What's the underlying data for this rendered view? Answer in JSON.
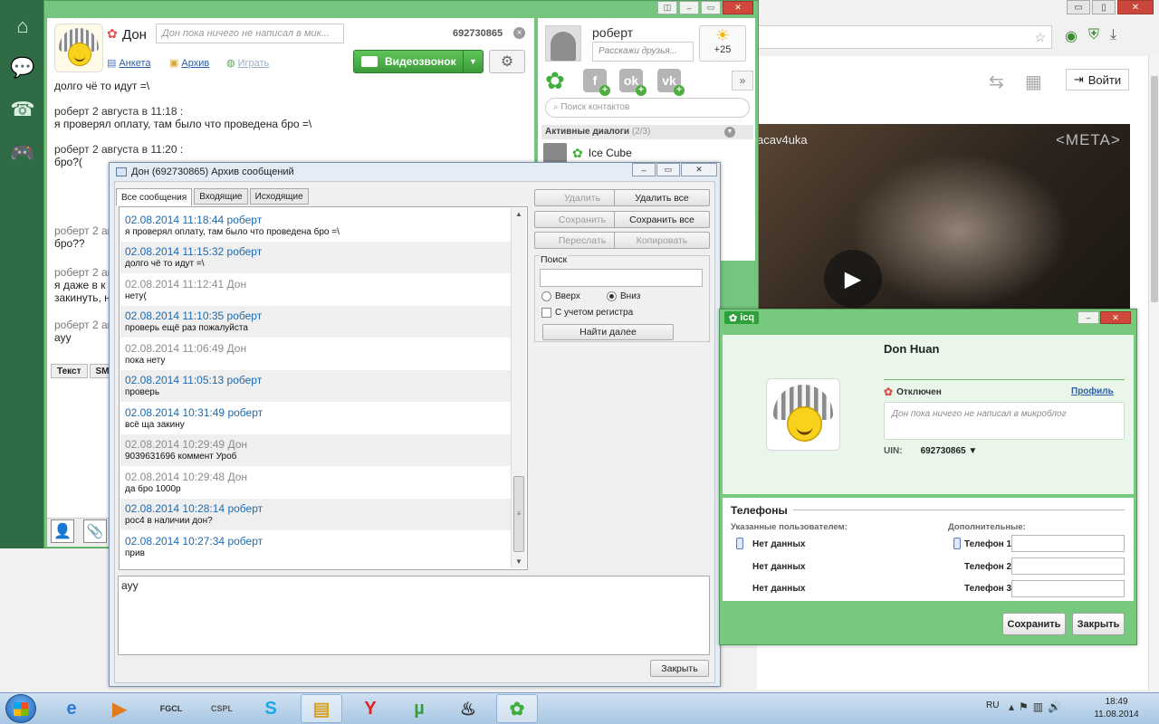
{
  "browser": {
    "login_label": "Войти",
    "video_title": "acav4uka",
    "video_brand": "<META>",
    "controls": [
      "▭",
      "▯",
      "✕"
    ]
  },
  "chat": {
    "contact_name": "Дон",
    "microblog_placeholder": "Дон пока ничего не написал в мик...",
    "uin": "692730865",
    "links": {
      "profile": "Анкета",
      "archive": "Архив",
      "play": "Играть"
    },
    "video_call": "Видеозвонок",
    "history": [
      {
        "meta": "",
        "text": "долго чё то идут =\\"
      },
      {
        "meta": "роберт 2 августа в 11:18 :",
        "text": "я проверял оплату, там было что проведена бро =\\"
      },
      {
        "meta": "роберт 2 августа в 11:20 :",
        "text": "бро?("
      },
      {
        "meta": "роберт 2 ав",
        "text": "бро??"
      },
      {
        "meta": "роберт 2 ав",
        "text": "я даже в к",
        "text2": "закинуть, н"
      },
      {
        "meta": "роберт 2 ав",
        "text": "ayy"
      }
    ],
    "input_tabs": [
      "Текст",
      "SM"
    ]
  },
  "contacts": {
    "my_name": "роберт",
    "status_placeholder": "Расскажи друзья...",
    "temperature": "+25",
    "search_placeholder": "Поиск контактов",
    "active_dialogs": "Активные диалоги",
    "active_count": "(2/3)",
    "contact": "Ice Cube",
    "more": "»"
  },
  "archive": {
    "title": "Дон (692730865) Архив сообщений",
    "tabs": [
      "Все сообщения",
      "Входящие",
      "Исходящие"
    ],
    "messages": [
      {
        "header": "02.08.2014 11:18:44 роберт",
        "text": "я проверял оплату, там было что проведена бро =\\",
        "own": true
      },
      {
        "header": "02.08.2014 11:15:32 роберт",
        "text": "долго чё то идут =\\",
        "own": true
      },
      {
        "header": "02.08.2014 11:12:41 Дон",
        "text": "нету(",
        "own": false
      },
      {
        "header": "02.08.2014 11:10:35 роберт",
        "text": "проверь ещё раз пожалуйста",
        "own": true
      },
      {
        "header": "02.08.2014 11:06:49 Дон",
        "text": "пока нету",
        "own": false
      },
      {
        "header": "02.08.2014 11:05:13 роберт",
        "text": "проверь",
        "own": true
      },
      {
        "header": "02.08.2014 10:31:49 роберт",
        "text": "всё ща закину",
        "own": true
      },
      {
        "header": "02.08.2014 10:29:49 Дон",
        "text": "9039631696 коммент Уроб",
        "own": false
      },
      {
        "header": "02.08.2014 10:29:48 Дон",
        "text": "да бро 1000р",
        "own": false
      },
      {
        "header": "02.08.2014 10:28:14 роберт",
        "text": "рос4 в наличии дон?",
        "own": true
      },
      {
        "header": "02.08.2014 10:27:34 роберт",
        "text": "прив",
        "own": true
      }
    ],
    "actions": {
      "delete": "Удалить",
      "delete_all": "Удалить все",
      "save": "Сохранить",
      "save_all": "Сохранить все",
      "forward": "Переслать",
      "copy": "Копировать"
    },
    "search_label": "Поиск",
    "up": "Вверх",
    "down": "Вниз",
    "case": "С учетом регистра",
    "find_next": "Найти далее",
    "input_value": "ayy",
    "close": "Закрыть"
  },
  "profile": {
    "logo": "icq",
    "name": "Don Huan",
    "status": "Отключен",
    "profile_link": "Профиль",
    "microblog": "Дон пока ничего не написал в микроблог",
    "uin_label": "UIN:",
    "uin": "692730865",
    "phones_title": "Телефоны",
    "user_specified": "Указанные пользователем:",
    "additional": "Дополнительные:",
    "no_data": "Нет данных",
    "phone1": "Телефон 1",
    "phone2": "Телефон 2",
    "phone3": "Телефон 3",
    "save": "Сохранить",
    "close": "Закрыть"
  },
  "taskbar": {
    "lang": "RU",
    "time": "18:49",
    "date": "11.08.2014"
  }
}
